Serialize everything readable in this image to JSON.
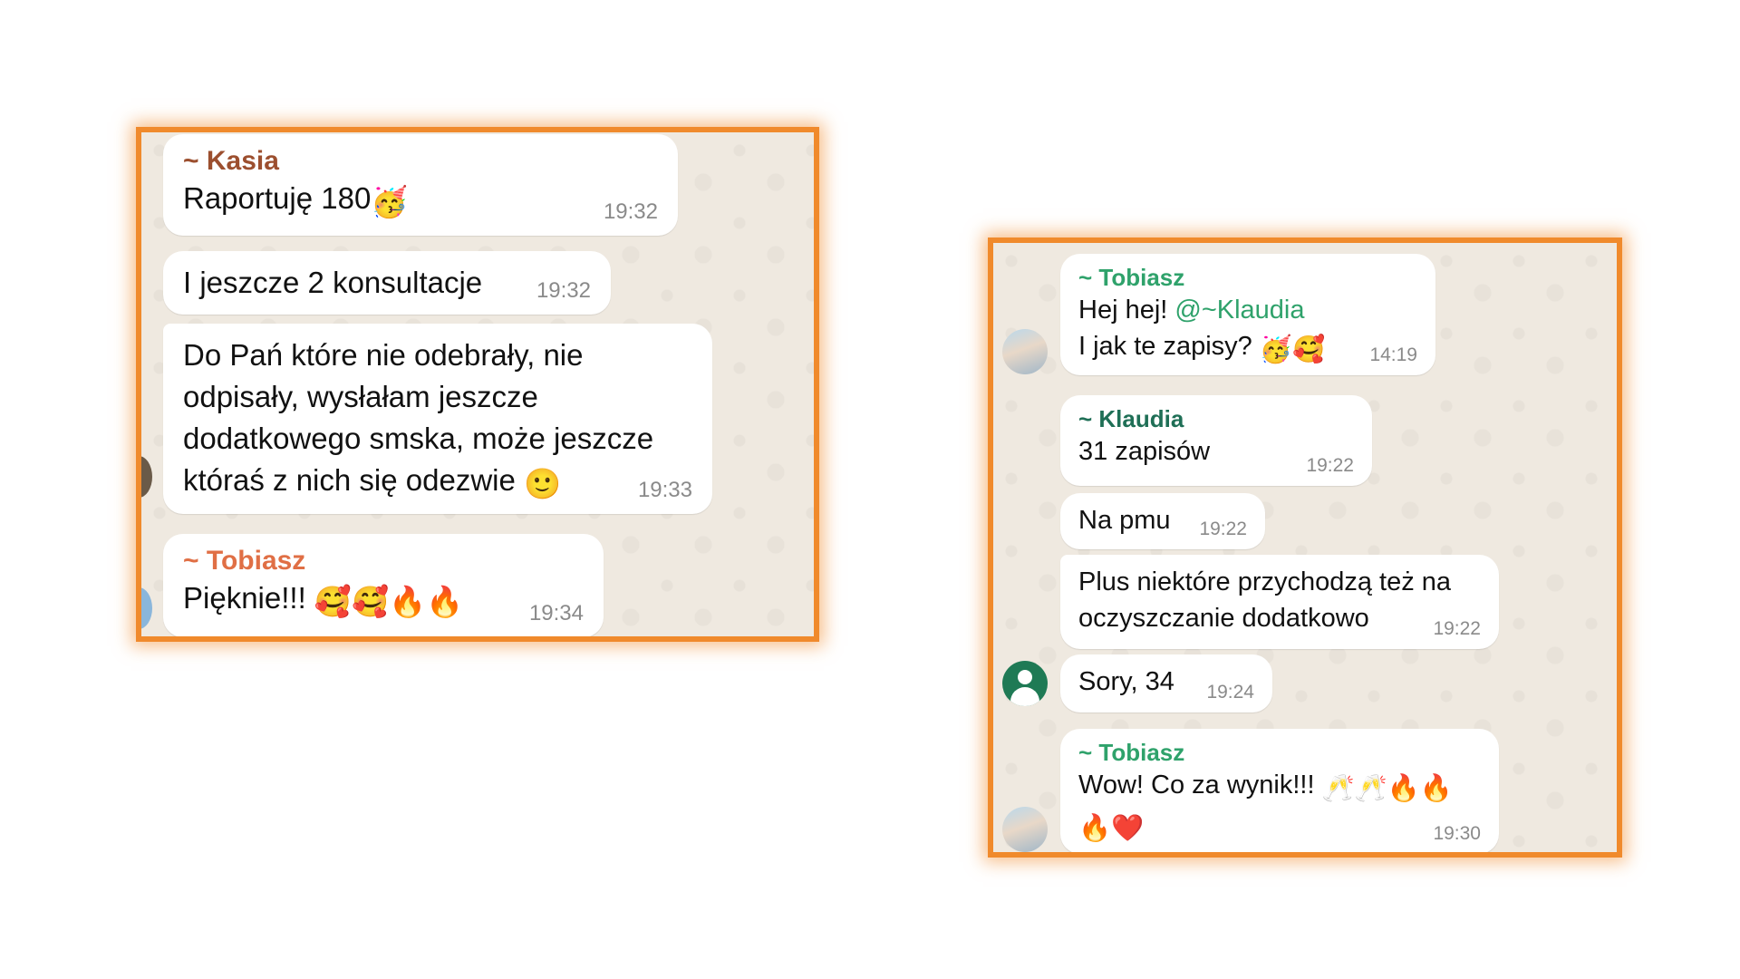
{
  "left_chat": {
    "messages": [
      {
        "sender": "~ Kasia",
        "text": "Raportuję 180",
        "emoji": "🥳",
        "time": "19:32"
      },
      {
        "text": "I jeszcze 2 konsultacje",
        "time": "19:32"
      },
      {
        "text": "Do Pań które nie odebrały, nie\nodpisały, wysłałam jeszcze\ndodatkowego smska, może jeszcze\nktóraś z nich się odezwie",
        "emoji": "🙂",
        "time": "19:33"
      },
      {
        "sender": "~ Tobiasz",
        "text": "Pięknie!!!",
        "emoji": "🥰🥰🔥🔥",
        "time": "19:34"
      }
    ]
  },
  "right_chat": {
    "messages": [
      {
        "sender": "~ Tobiasz",
        "line1": "Hej hej!",
        "mention": "@~Klaudia",
        "line2": "I jak te zapisy?",
        "emoji": "🥳🥰",
        "time": "14:19"
      },
      {
        "sender": "~ Klaudia",
        "text": "31 zapisów",
        "time": "19:22"
      },
      {
        "text": "Na pmu",
        "time": "19:22"
      },
      {
        "text": "Plus niektóre przychodzą też na\noczyszczanie dodatkowo",
        "time": "19:22"
      },
      {
        "text": "Sory, 34",
        "time": "19:24"
      },
      {
        "sender": "~ Tobiasz",
        "text": "Wow! Co za wynik!!!",
        "emoji": "🥂🥂🔥🔥",
        "emoji2": "🔥❤️",
        "time": "19:30"
      }
    ]
  },
  "colors": {
    "panel_border": "#f08a2c",
    "wallpaper": "#efe9e0",
    "kasia": "#9c4f2f",
    "tobiasz_left": "#e06f45",
    "tobiasz_right": "#2fa26b",
    "klaudia": "#1f6f56"
  }
}
